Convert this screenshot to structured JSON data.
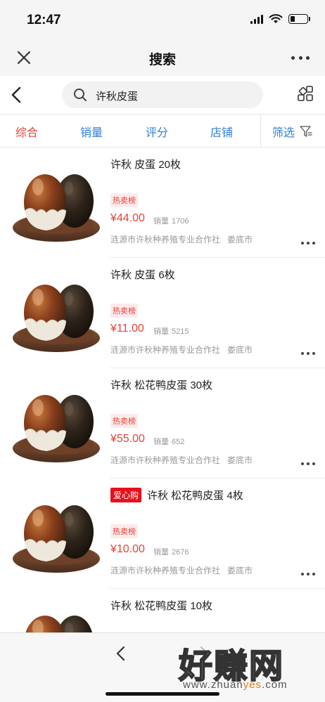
{
  "status_bar": {
    "time": "12:47",
    "battery_level": 0.25
  },
  "nav": {
    "title": "搜索"
  },
  "search": {
    "query": "许秋皮蛋"
  },
  "sort_tabs": [
    {
      "label": "综合",
      "active": true
    },
    {
      "label": "销量",
      "active": false
    },
    {
      "label": "评分",
      "active": false
    },
    {
      "label": "店铺",
      "active": false
    },
    {
      "label": "筛选",
      "active": false
    }
  ],
  "products": [
    {
      "badge": "",
      "title": "许秋 皮蛋 20枚",
      "tag": "热卖榜",
      "price": "¥44.00",
      "sales_label": "销量",
      "sales": "1706",
      "shop": "涟源市许秋种养殖专业合作社",
      "city": "娄底市"
    },
    {
      "badge": "",
      "title": "许秋 皮蛋 6枚",
      "tag": "热卖榜",
      "price": "¥11.00",
      "sales_label": "销量",
      "sales": "5215",
      "shop": "涟源市许秋种养殖专业合作社",
      "city": "娄底市"
    },
    {
      "badge": "",
      "title": "许秋 松花鸭皮蛋 30枚",
      "tag": "热卖榜",
      "price": "¥55.00",
      "sales_label": "销量",
      "sales": "652",
      "shop": "涟源市许秋种养殖专业合作社",
      "city": "娄底市"
    },
    {
      "badge": "爱心购",
      "title": "许秋 松花鸭皮蛋 4枚",
      "tag": "热卖榜",
      "price": "¥10.00",
      "sales_label": "销量",
      "sales": "2676",
      "shop": "涟源市许秋种养殖专业合作社",
      "city": "娄底市"
    },
    {
      "badge": "",
      "title": "许秋 松花鸭皮蛋 10枚",
      "tag": "",
      "price": "",
      "sales_label": "",
      "sales": "",
      "shop": "",
      "city": ""
    }
  ],
  "watermark": {
    "main": "好赚网",
    "url_pre": "www.zhuan",
    "url_hl": "yes",
    "url_post": ".com"
  },
  "colors": {
    "accent_red": "#e5423a",
    "link_blue": "#2f7fd8",
    "love_red": "#e8101c"
  }
}
